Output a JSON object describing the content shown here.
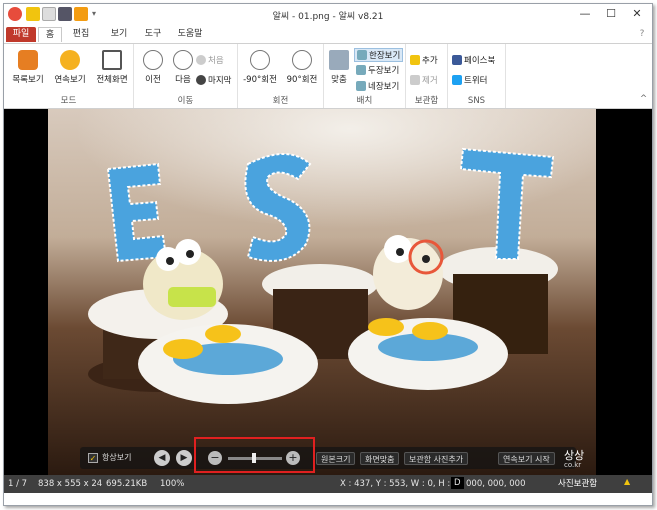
{
  "window": {
    "title": "알씨 - 01.png - 알씨 v8.21",
    "controls": [
      "—",
      "☐",
      "✕"
    ]
  },
  "menu": {
    "tabs": [
      "파일",
      "홈",
      "편집",
      "보기",
      "도구",
      "도움말"
    ]
  },
  "ribbon": {
    "mode": {
      "label": "모드",
      "buttons": [
        "목록보기",
        "연속보기",
        "전체화면"
      ]
    },
    "move": {
      "label": "이동",
      "prev": "이전",
      "next": "다음",
      "first": "처음",
      "last": "마지막"
    },
    "rotate": {
      "label": "회전",
      "left": "-90°회전",
      "right": "90°회전"
    },
    "layout": {
      "label": "배치",
      "fit": "맞춤",
      "one": "한장보기",
      "two": "두장보기",
      "four": "네장보기"
    },
    "keep": {
      "label": "보관함",
      "add": "추가",
      "remove": "제거"
    },
    "sns": {
      "label": "SNS",
      "facebook": "페이스북",
      "twitter": "트위터"
    }
  },
  "viewer": {
    "overlay": {
      "always_show": "항상보기",
      "original": "원본크기",
      "fit": "화면맞춤",
      "keep_add": "보관함 사진추가",
      "slideshow": "연속보기 시작"
    },
    "watermark": {
      "main": "상상",
      "sub": "co.kr"
    }
  },
  "status": {
    "index": "1 / 7",
    "dims": "838 x 555 x 24",
    "size": "695.21KB",
    "zoom": "100%",
    "coords": "X : 437, Y : 553, W : 0, H : 0",
    "d": "D",
    "color": "000, 000, 000",
    "album": "사진보관함"
  }
}
